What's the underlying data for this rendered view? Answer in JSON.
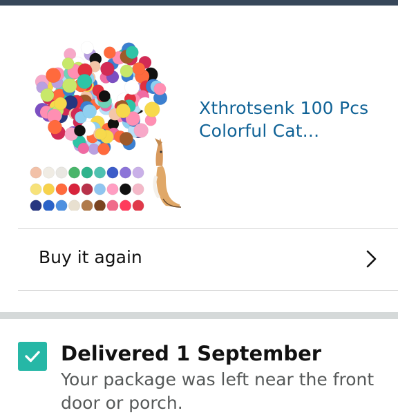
{
  "product": {
    "title": "Xthrotsenk 100 Pcs Colorful Cat...",
    "image_icon": "pompom-balls-product-image"
  },
  "buy_again": {
    "label": "Buy it again",
    "icon": "chevron-right-icon"
  },
  "delivery": {
    "title": "Delivered 1 September",
    "description": "Your package was left near the front door or porch.",
    "icon": "check-icon"
  },
  "colors": {
    "link": "#0f6296",
    "check": "#26b7a6",
    "header": "#37475a"
  }
}
